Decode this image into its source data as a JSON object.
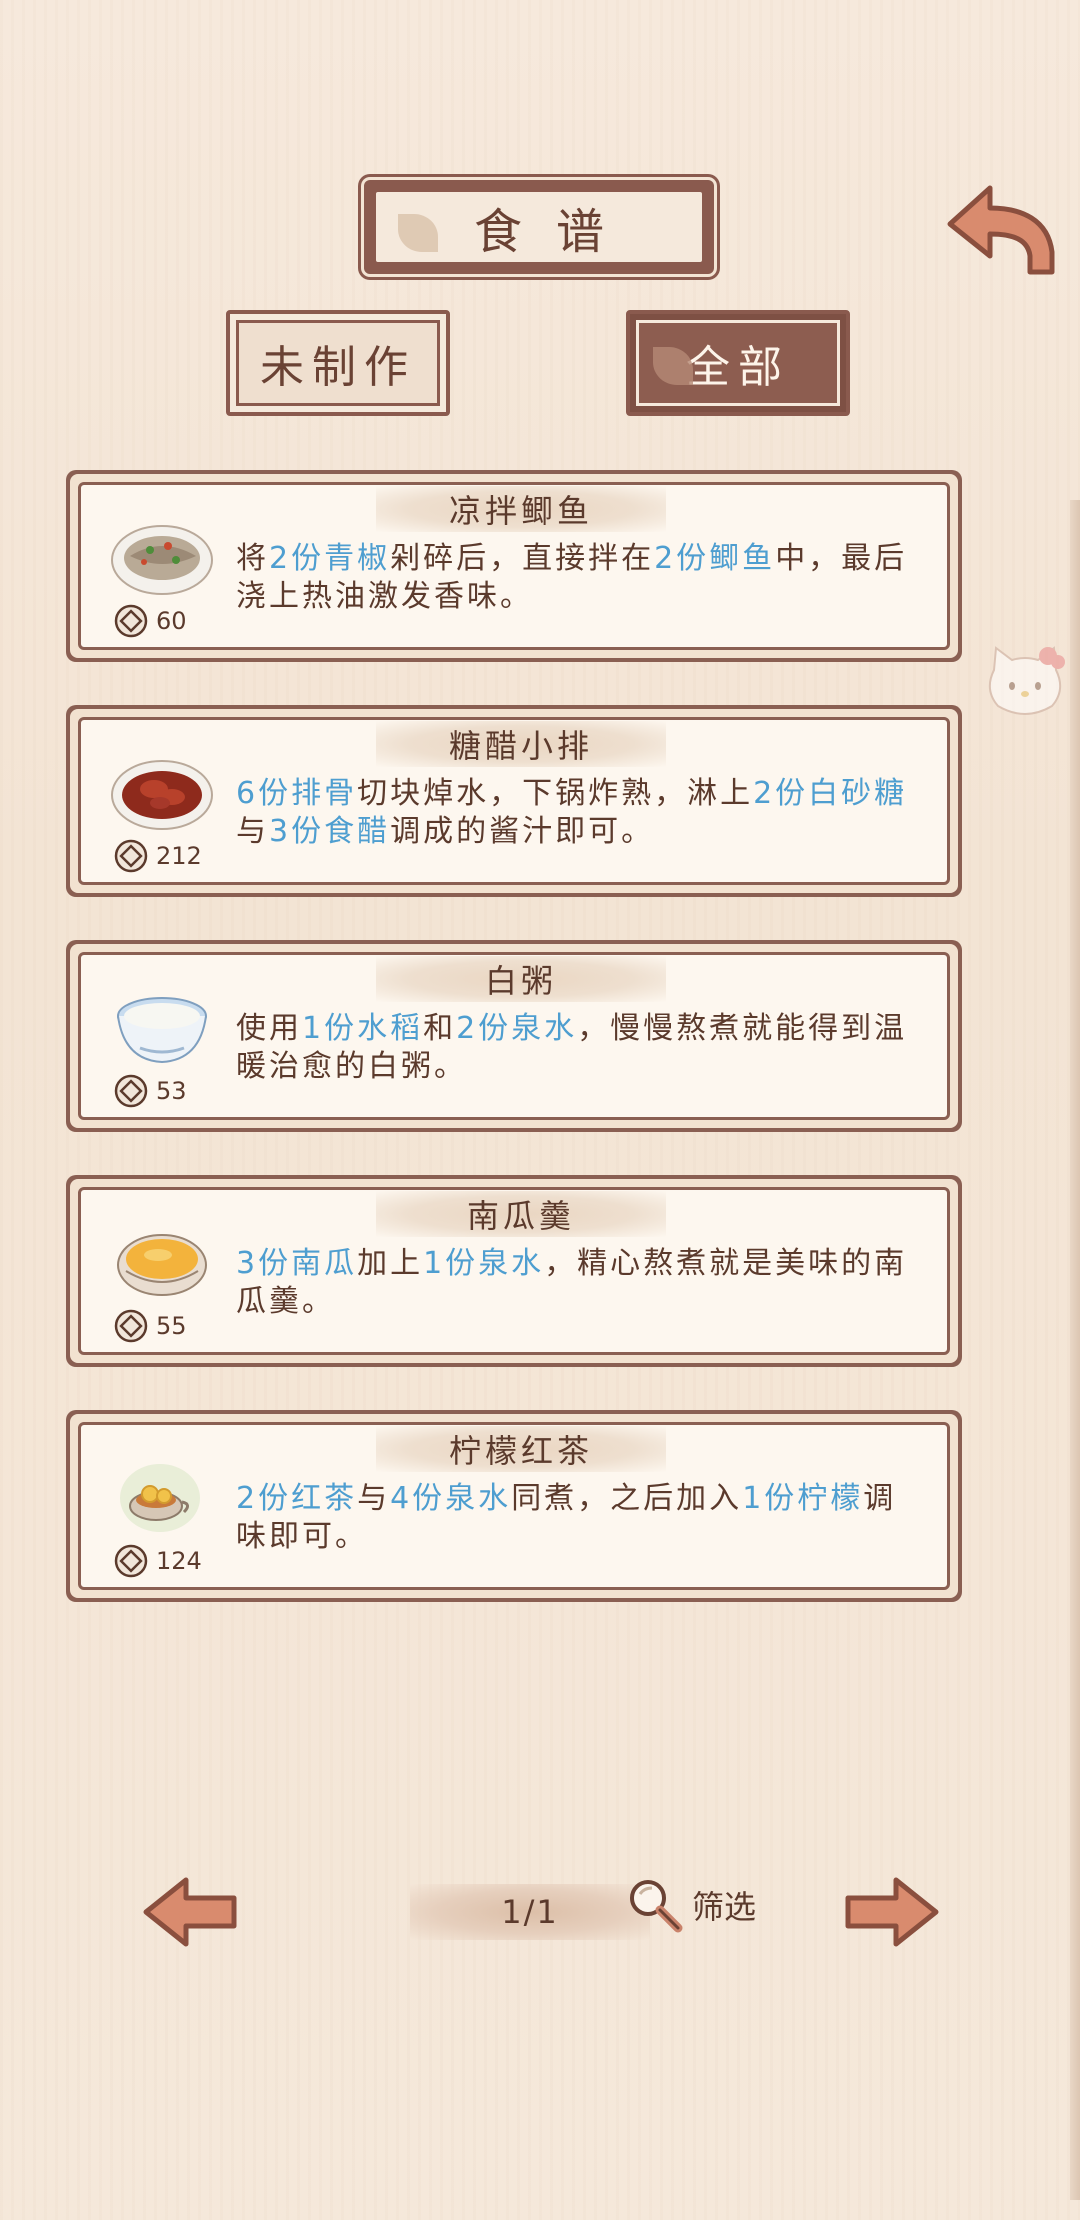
{
  "header": {
    "title": "食谱"
  },
  "tabs": [
    {
      "label": "未制作",
      "active": false
    },
    {
      "label": "全部",
      "active": true
    }
  ],
  "recipes": [
    {
      "name": "凉拌鲫鱼",
      "price": "60",
      "dish_icon": "fish-plate-icon",
      "desc": [
        {
          "t": "将",
          "hl": false
        },
        {
          "t": "2份青椒",
          "hl": true
        },
        {
          "t": "剁碎后，直接拌在",
          "hl": false
        },
        {
          "t": "2份鲫鱼",
          "hl": true
        },
        {
          "t": "中，最后浇上热油激发香味。",
          "hl": false
        }
      ]
    },
    {
      "name": "糖醋小排",
      "price": "212",
      "dish_icon": "ribs-plate-icon",
      "desc": [
        {
          "t": "6份排骨",
          "hl": true
        },
        {
          "t": "切块焯水，下锅炸熟，淋上",
          "hl": false
        },
        {
          "t": "2份白砂糖",
          "hl": true
        },
        {
          "t": "与",
          "hl": false
        },
        {
          "t": "3份食醋",
          "hl": true
        },
        {
          "t": "调成的酱汁即可。",
          "hl": false
        }
      ]
    },
    {
      "name": "白粥",
      "price": "53",
      "dish_icon": "rice-porridge-bowl-icon",
      "desc": [
        {
          "t": "使用",
          "hl": false
        },
        {
          "t": "1份水稻",
          "hl": true
        },
        {
          "t": "和",
          "hl": false
        },
        {
          "t": "2份泉水",
          "hl": true
        },
        {
          "t": "，慢慢熬煮就能得到温暖治愈的白粥。",
          "hl": false
        }
      ]
    },
    {
      "name": "南瓜羹",
      "price": "55",
      "dish_icon": "pumpkin-soup-bowl-icon",
      "desc": [
        {
          "t": "3份南瓜",
          "hl": true
        },
        {
          "t": "加上",
          "hl": false
        },
        {
          "t": "1份泉水",
          "hl": true
        },
        {
          "t": "，精心熬煮就是美味的南瓜羹。",
          "hl": false
        }
      ]
    },
    {
      "name": "柠檬红茶",
      "price": "124",
      "dish_icon": "lemon-tea-cup-icon",
      "desc": [
        {
          "t": "2份红茶",
          "hl": true
        },
        {
          "t": "与",
          "hl": false
        },
        {
          "t": "4份泉水",
          "hl": true
        },
        {
          "t": "同煮，之后加入",
          "hl": false
        },
        {
          "t": "1份柠檬",
          "hl": true
        },
        {
          "t": "调味即可。",
          "hl": false
        }
      ]
    }
  ],
  "pagination": {
    "page": "1/1",
    "filter_label": "筛选"
  },
  "colors": {
    "wood": "#8a5a4e",
    "paper": "#fdf7ef",
    "highlight": "#4e9ed0",
    "text": "#5b3a2c"
  }
}
